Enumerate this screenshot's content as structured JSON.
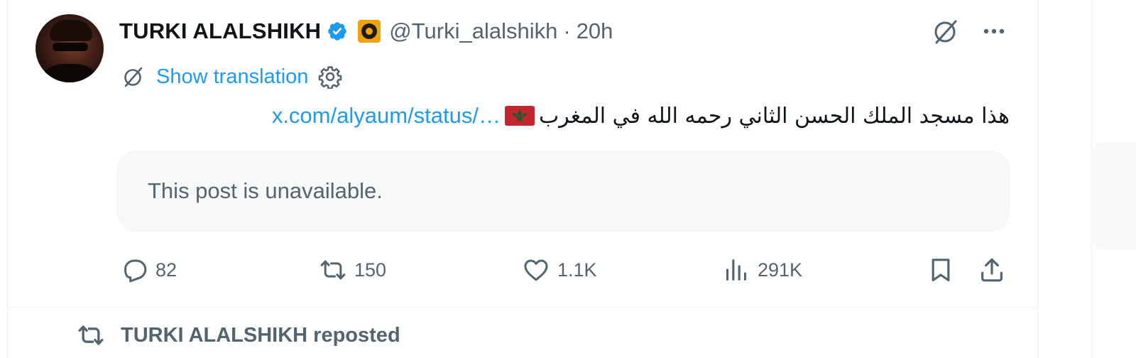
{
  "tweet": {
    "author": {
      "display_name": "TURKI ALALSHIKH",
      "handle": "@Turki_alalshikh",
      "separator": "·",
      "time": "20h",
      "avatar_icon": "profile-photo",
      "verified_icon": "verified-badge-icon",
      "affiliation_icon": "lion-affiliation-badge"
    },
    "translation": {
      "label": "Show translation",
      "icon": "grok-icon",
      "settings_icon": "gear-icon"
    },
    "body": {
      "arabic_text": "هذا مسجد الملك الحسن الثاني رحمه الله في المغرب",
      "flag_icon": "morocco-flag",
      "link": "x.com/alyaum/status/…"
    },
    "quote": {
      "text": "This post is unavailable."
    },
    "actions": {
      "reply_count": "82",
      "repost_count": "150",
      "like_count": "1.1K",
      "views_count": "291K"
    }
  },
  "next_item": {
    "repost_label": "TURKI ALALSHIKH reposted"
  },
  "colors": {
    "accent": "#1d9bf0",
    "text_primary": "#0f1419",
    "text_secondary": "#536471",
    "card_bg": "#f7f9f9",
    "flag_red": "#c1272d",
    "flag_star": "#006233",
    "affiliation_gold": "#f4a20a"
  }
}
